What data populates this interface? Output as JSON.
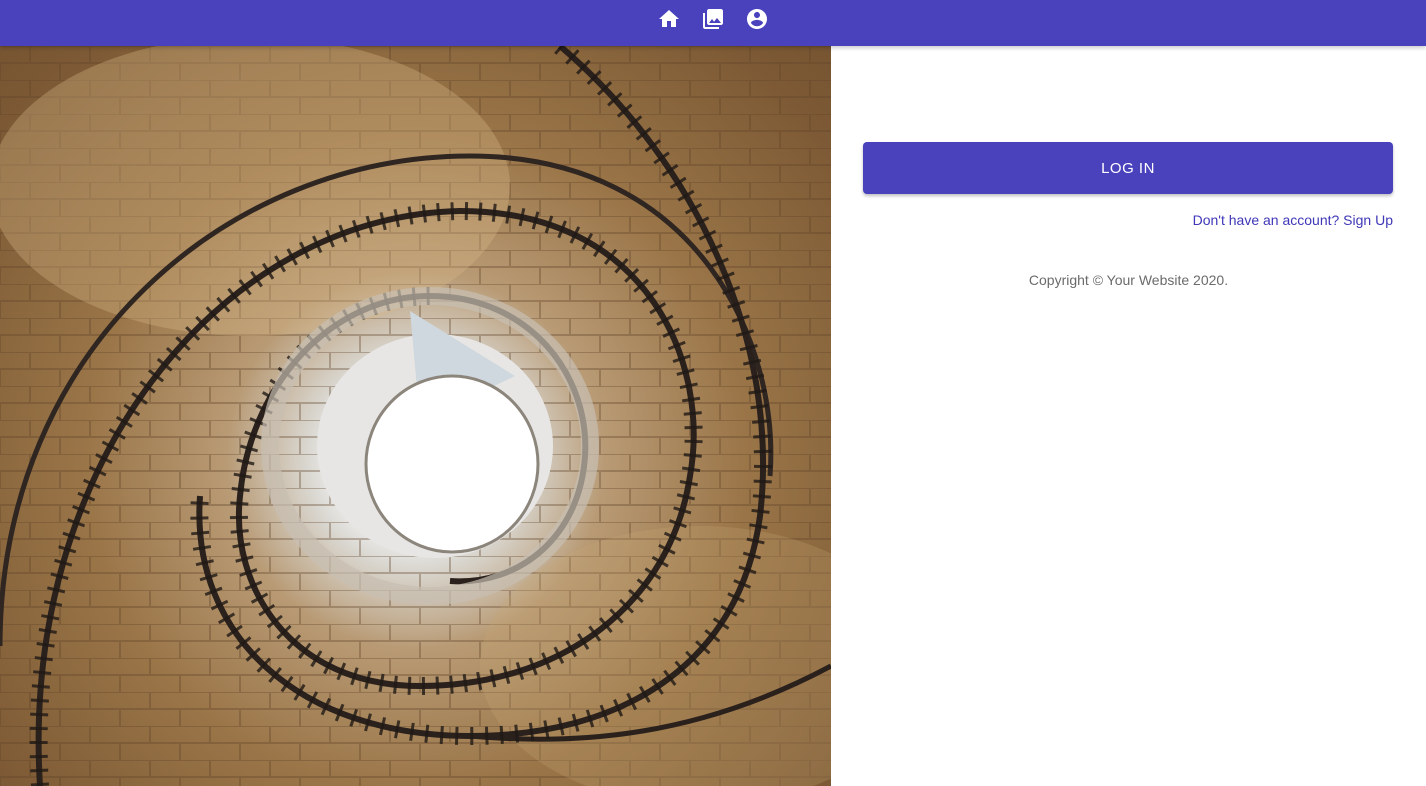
{
  "nav": {
    "icons": [
      "home-icon",
      "photo-library-icon",
      "account-circle-icon"
    ],
    "color": "#4a41bd"
  },
  "hero": {
    "description_icon": "spiral-staircase-photo"
  },
  "login": {
    "button_label": "LOG IN",
    "signup_text": "Don't have an account? Sign Up",
    "copyright": "Copyright © Your Website 2020."
  }
}
